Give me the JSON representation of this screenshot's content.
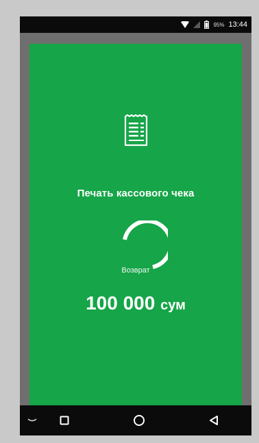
{
  "status_bar": {
    "battery_percent": "95%",
    "time": "13:44",
    "icons": [
      "wifi-icon",
      "signal-icon",
      "battery-icon"
    ]
  },
  "main": {
    "icon": "receipt-icon",
    "title": "Печать кассового чека",
    "spinner": "loading-spinner",
    "subtitle": "Возврат",
    "amount_value": "100 000",
    "amount_unit": "сум"
  },
  "nav_bar": {
    "icons": [
      "collapse-icon",
      "recent-apps-icon",
      "home-icon",
      "back-icon"
    ]
  },
  "colors": {
    "screen_background": "#16a548",
    "bezel": "#6f6f6f",
    "bars": "#0b0b0b",
    "text": "#ffffff"
  }
}
